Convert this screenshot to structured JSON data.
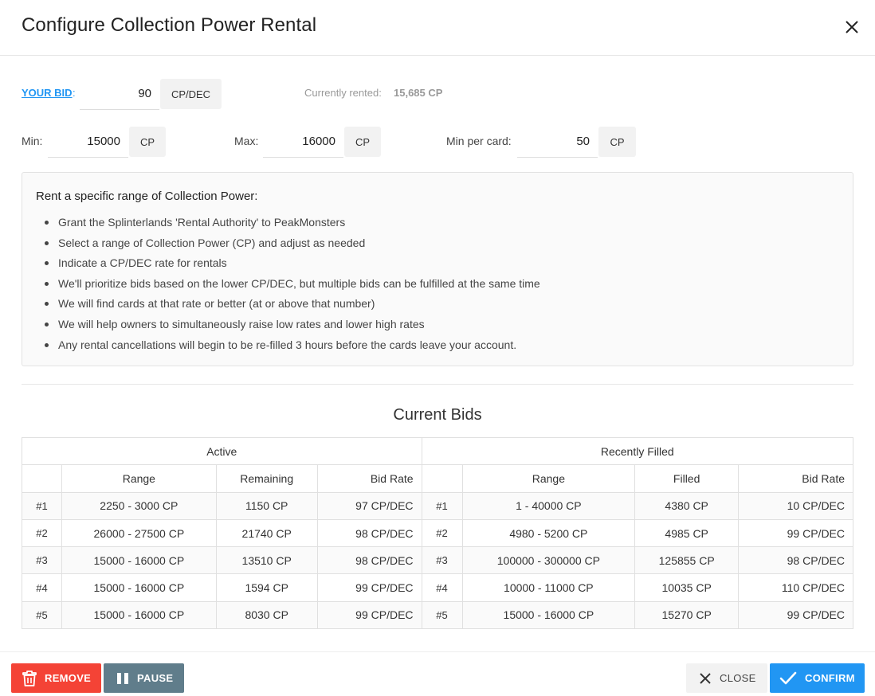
{
  "dialog": {
    "title": "Configure Collection Power Rental"
  },
  "bid": {
    "label": "YOUR BID",
    "colon": ":",
    "value": "90",
    "unit": "CP/DEC",
    "rented_label": "Currently rented:",
    "rented_value": "15,685 CP"
  },
  "range": {
    "min_label": "Min:",
    "min_value": "15000",
    "min_unit": "CP",
    "max_label": "Max:",
    "max_value": "16000",
    "max_unit": "CP",
    "per_card_label": "Min per card:",
    "per_card_value": "50",
    "per_card_unit": "CP"
  },
  "info": {
    "title": "Rent a specific range of Collection Power:",
    "items": [
      "Grant the Splinterlands 'Rental Authority' to PeakMonsters",
      "Select a range of Collection Power (CP) and adjust as needed",
      "Indicate a CP/DEC rate for rentals",
      "We'll prioritize bids based on the lower CP/DEC, but multiple bids can be fulfilled at the same time",
      "We will find cards at that rate or better (at or above that number)",
      "We will help owners to simultaneously raise low rates and lower high rates",
      "Any rental cancellations will begin to be re-filled 3 hours before the cards leave your account."
    ]
  },
  "bids": {
    "title": "Current Bids",
    "active_header": "Active",
    "filled_header": "Recently Filled",
    "active_cols": [
      "Range",
      "Remaining",
      "Bid Rate"
    ],
    "filled_cols": [
      "Range",
      "Filled",
      "Bid Rate"
    ],
    "rows": [
      {
        "a_idx": "#1",
        "a_range": "2250 - 3000 CP",
        "a_remaining": "1150 CP",
        "a_rate": "97 CP/DEC",
        "f_idx": "#1",
        "f_range": "1 - 40000 CP",
        "f_filled": "4380 CP",
        "f_rate": "10 CP/DEC"
      },
      {
        "a_idx": "#2",
        "a_range": "26000 - 27500 CP",
        "a_remaining": "21740 CP",
        "a_rate": "98 CP/DEC",
        "f_idx": "#2",
        "f_range": "4980 - 5200 CP",
        "f_filled": "4985 CP",
        "f_rate": "99 CP/DEC"
      },
      {
        "a_idx": "#3",
        "a_range": "15000 - 16000 CP",
        "a_remaining": "13510 CP",
        "a_rate": "98 CP/DEC",
        "f_idx": "#3",
        "f_range": "100000 - 300000 CP",
        "f_filled": "125855 CP",
        "f_rate": "98 CP/DEC"
      },
      {
        "a_idx": "#4",
        "a_range": "15000 - 16000 CP",
        "a_remaining": "1594 CP",
        "a_rate": "99 CP/DEC",
        "f_idx": "#4",
        "f_range": "10000 - 11000 CP",
        "f_filled": "10035 CP",
        "f_rate": "110 CP/DEC"
      },
      {
        "a_idx": "#5",
        "a_range": "15000 - 16000 CP",
        "a_remaining": "8030 CP",
        "a_rate": "99 CP/DEC",
        "f_idx": "#5",
        "f_range": "15000 - 16000 CP",
        "f_filled": "15270 CP",
        "f_rate": "99 CP/DEC"
      }
    ]
  },
  "footer": {
    "remove_label": "REMOVE",
    "pause_label": "PAUSE",
    "close_label": "CLOSE",
    "confirm_label": "CONFIRM"
  },
  "icons": {
    "close": "close-icon",
    "remove": "trash-icon",
    "pause": "pause-icon",
    "cancel": "x-icon",
    "confirm": "check-icon"
  },
  "colors": {
    "accent": "#2196f3",
    "danger": "#f44336",
    "neutral": "#607d8b"
  }
}
